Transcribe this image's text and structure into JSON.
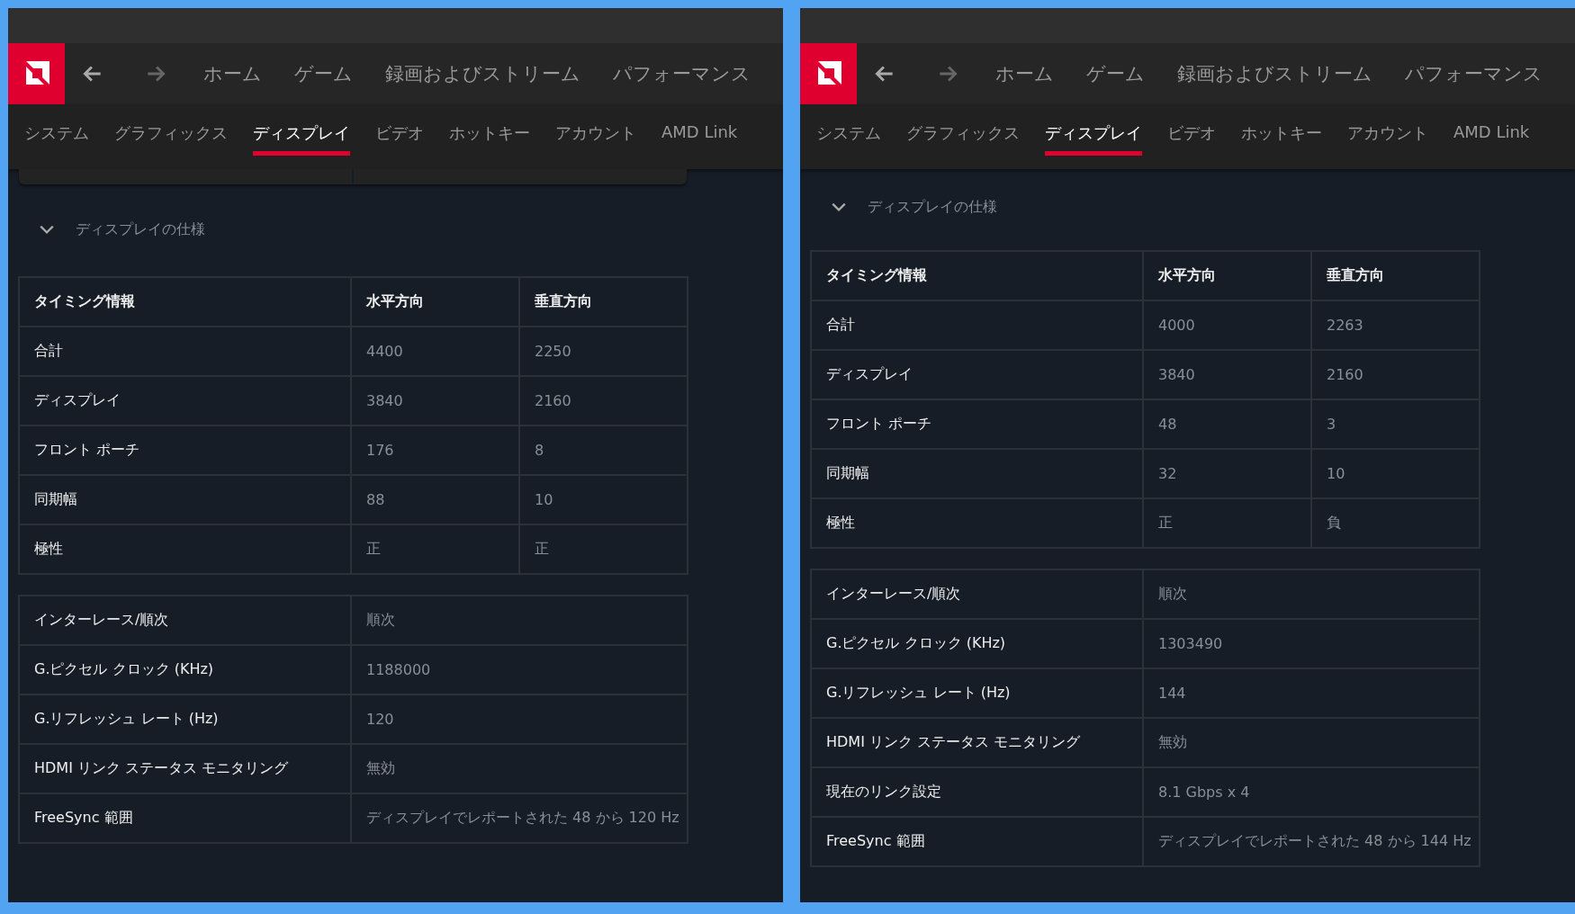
{
  "panels": [
    {
      "nav": [
        "ホーム",
        "ゲーム",
        "録画およびストリーム",
        "パフォーマンス"
      ],
      "tabs": [
        {
          "label": "システム",
          "selected": false
        },
        {
          "label": "グラフィックス",
          "selected": false
        },
        {
          "label": "ディスプレイ",
          "selected": true
        },
        {
          "label": "ビデオ",
          "selected": false
        },
        {
          "label": "ホットキー",
          "selected": false
        },
        {
          "label": "アカウント",
          "selected": false
        },
        {
          "label": "AMD Link",
          "selected": false
        }
      ],
      "cut_card_above": true,
      "section": {
        "title": "ディスプレイの仕様",
        "expanded": true
      },
      "timing_table": {
        "columns": [
          "タイミング情報",
          "水平方向",
          "垂直方向"
        ],
        "rows": [
          [
            "合計",
            "4400",
            "2250"
          ],
          [
            "ディスプレイ",
            "3840",
            "2160"
          ],
          [
            "フロント ポーチ",
            "176",
            "8"
          ],
          [
            "同期幅",
            "88",
            "10"
          ],
          [
            "極性",
            "正",
            "正"
          ]
        ]
      },
      "info_table": [
        [
          "インターレース/順次",
          "順次"
        ],
        [
          "G.ピクセル クロック (KHz)",
          "1188000"
        ],
        [
          "G.リフレッシュ レート (Hz)",
          "120"
        ],
        [
          "HDMI リンク ステータス モニタリング",
          "無効"
        ],
        [
          "FreeSync 範囲",
          "ディスプレイでレポートされた 48 から 120 Hz"
        ]
      ]
    },
    {
      "nav": [
        "ホーム",
        "ゲーム",
        "録画およびストリーム",
        "パフォーマンス"
      ],
      "tabs": [
        {
          "label": "システム",
          "selected": false
        },
        {
          "label": "グラフィックス",
          "selected": false
        },
        {
          "label": "ディスプレイ",
          "selected": true
        },
        {
          "label": "ビデオ",
          "selected": false
        },
        {
          "label": "ホットキー",
          "selected": false
        },
        {
          "label": "アカウント",
          "selected": false
        },
        {
          "label": "AMD Link",
          "selected": false
        }
      ],
      "cut_card_above": false,
      "section": {
        "title": "ディスプレイの仕様",
        "expanded": true
      },
      "timing_table": {
        "columns": [
          "タイミング情報",
          "水平方向",
          "垂直方向"
        ],
        "rows": [
          [
            "合計",
            "4000",
            "2263"
          ],
          [
            "ディスプレイ",
            "3840",
            "2160"
          ],
          [
            "フロント ポーチ",
            "48",
            "3"
          ],
          [
            "同期幅",
            "32",
            "10"
          ],
          [
            "極性",
            "正",
            "負"
          ]
        ]
      },
      "info_table": [
        [
          "インターレース/順次",
          "順次"
        ],
        [
          "G.ピクセル クロック (KHz)",
          "1303490"
        ],
        [
          "G.リフレッシュ レート (Hz)",
          "144"
        ],
        [
          "HDMI リンク ステータス モニタリング",
          "無効"
        ],
        [
          "現在のリンク設定",
          "8.1 Gbps x 4"
        ],
        [
          "FreeSync 範囲",
          "ディスプレイでレポートされた 48 から 144 Hz"
        ]
      ]
    }
  ]
}
